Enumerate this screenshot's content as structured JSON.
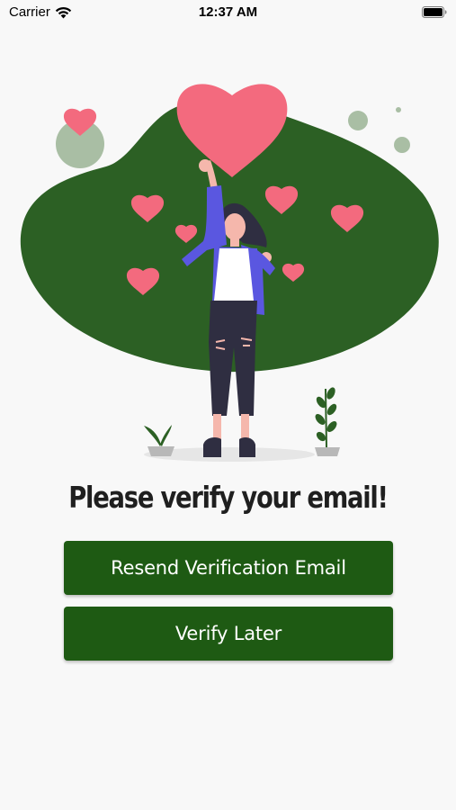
{
  "status_bar": {
    "carrier": "Carrier",
    "time": "12:37 AM"
  },
  "illustration": {
    "description_icon": "woman-with-hearts-illustration",
    "colors": {
      "blob": "#2c6024",
      "heart": "#f36a7e",
      "jacket": "#5a57e0",
      "circle": "#a9bea4"
    }
  },
  "main": {
    "headline": "Please verify your email!",
    "resend_button_label": "Resend Verification Email",
    "verify_later_button_label": "Verify Later"
  },
  "colors": {
    "button_bg": "#1e5a13",
    "button_text": "#ffffff",
    "background": "#f8f8f8"
  }
}
